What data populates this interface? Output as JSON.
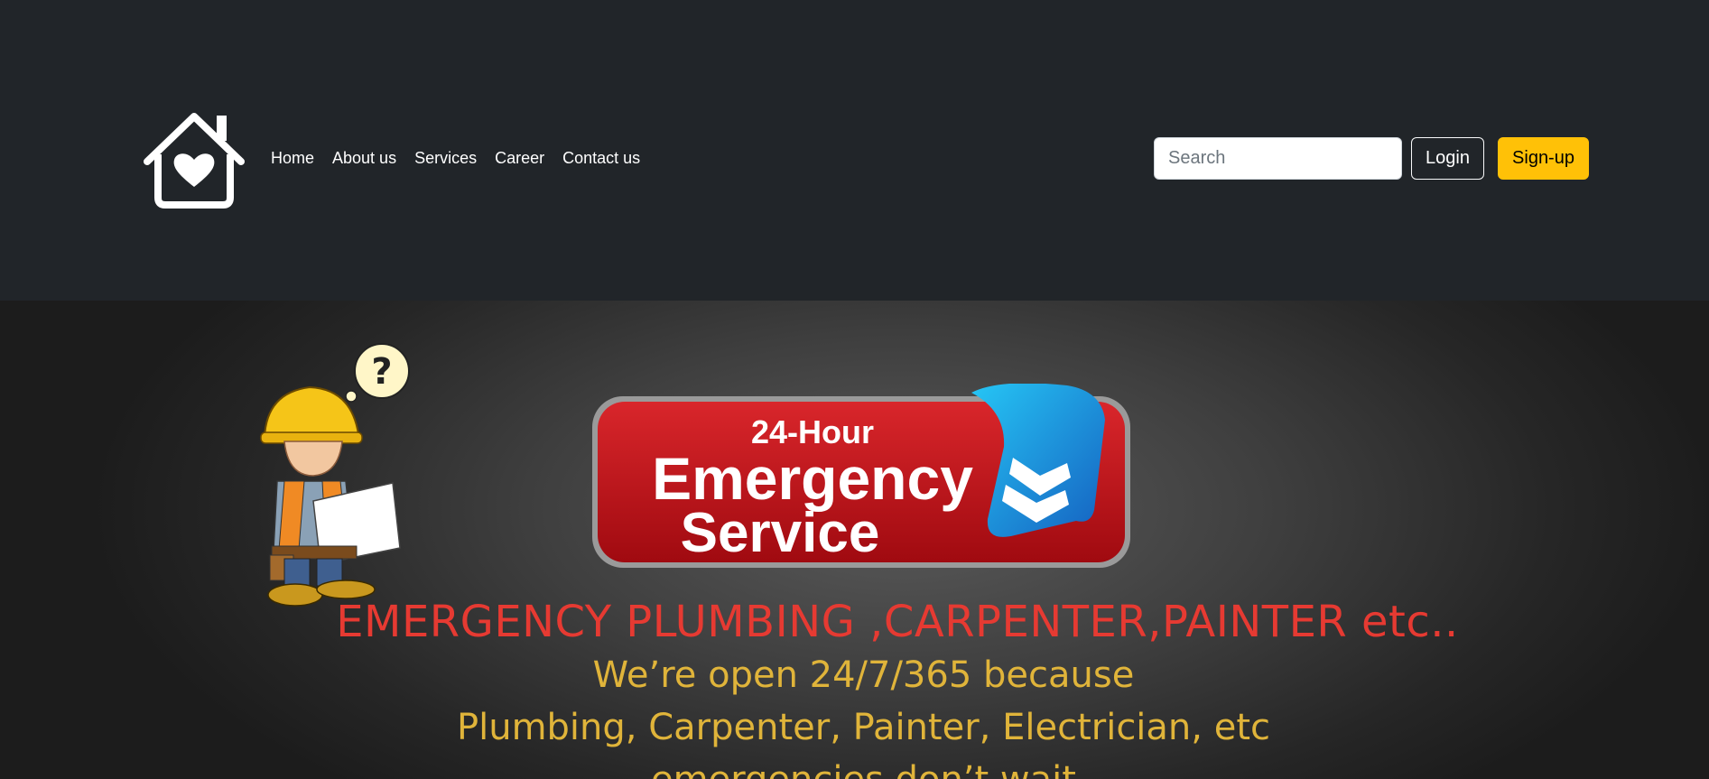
{
  "nav": {
    "logo_icon": "house-heart-icon",
    "links": [
      "Home",
      "About us",
      "Services",
      "Career",
      "Contact us"
    ],
    "search_placeholder": "Search",
    "login_label": "Login",
    "signup_label": "Sign-up"
  },
  "hero": {
    "badge": {
      "line1": "24-Hour",
      "line2": "Emergency",
      "line3": "Service"
    },
    "question_mark": "?",
    "headline": "EMERGENCY PLUMBING ,CARPENTER,PAINTER etc..",
    "lines": [
      "We’re open 24/7/365 because",
      "Plumbing, Carpenter, Painter, Electrician, etc",
      "emergencies don’t wait"
    ]
  },
  "colors": {
    "navbar_bg": "#212529",
    "signup_bg": "#ffc107",
    "headline": "#e63a32",
    "subtext": "#e0b43a",
    "badge_red": "#c4151c",
    "badge_ribbon": "#1e88e5"
  }
}
